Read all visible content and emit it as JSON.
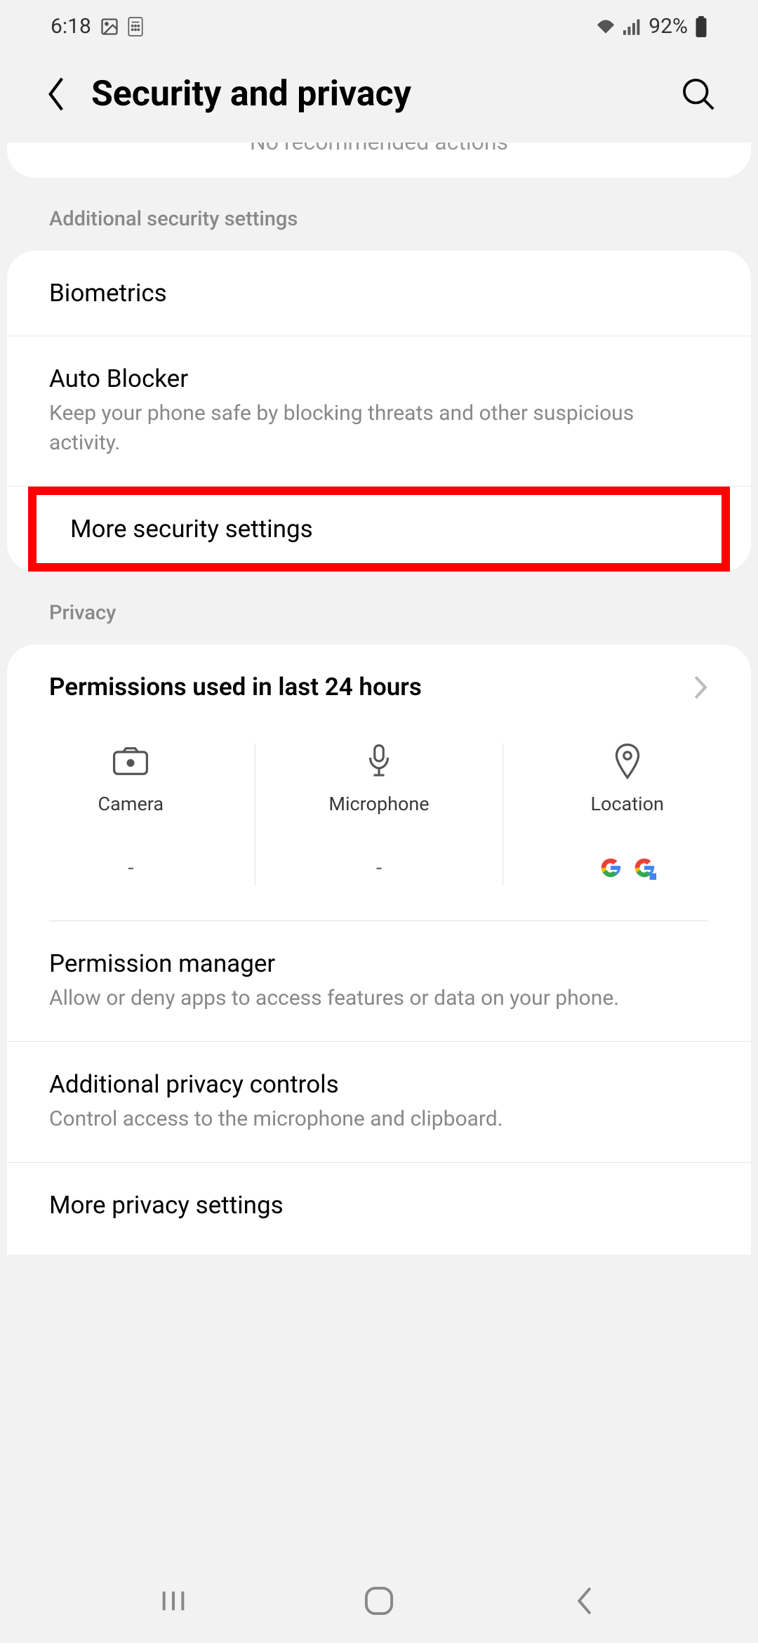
{
  "status_bar": {
    "time": "6:18",
    "battery": "92%"
  },
  "header": {
    "title": "Security and privacy"
  },
  "top_card_text": "No recommended actions",
  "sections": {
    "security_header": "Additional security settings",
    "privacy_header": "Privacy"
  },
  "security_items": {
    "biometrics": "Biometrics",
    "auto_blocker": {
      "title": "Auto Blocker",
      "subtitle": "Keep your phone safe by blocking threats and other suspicious activity."
    },
    "more_security": "More security settings"
  },
  "privacy_items": {
    "permissions_24h": "Permissions used in last 24 hours",
    "perm_cols": {
      "camera": {
        "label": "Camera",
        "apps": "-"
      },
      "microphone": {
        "label": "Microphone",
        "apps": "-"
      },
      "location": {
        "label": "Location",
        "apps": "google"
      }
    },
    "permission_manager": {
      "title": "Permission manager",
      "subtitle": "Allow or deny apps to access features or data on your phone."
    },
    "additional_privacy": {
      "title": "Additional privacy controls",
      "subtitle": "Control access to the microphone and clipboard."
    },
    "more_privacy": "More privacy settings"
  }
}
